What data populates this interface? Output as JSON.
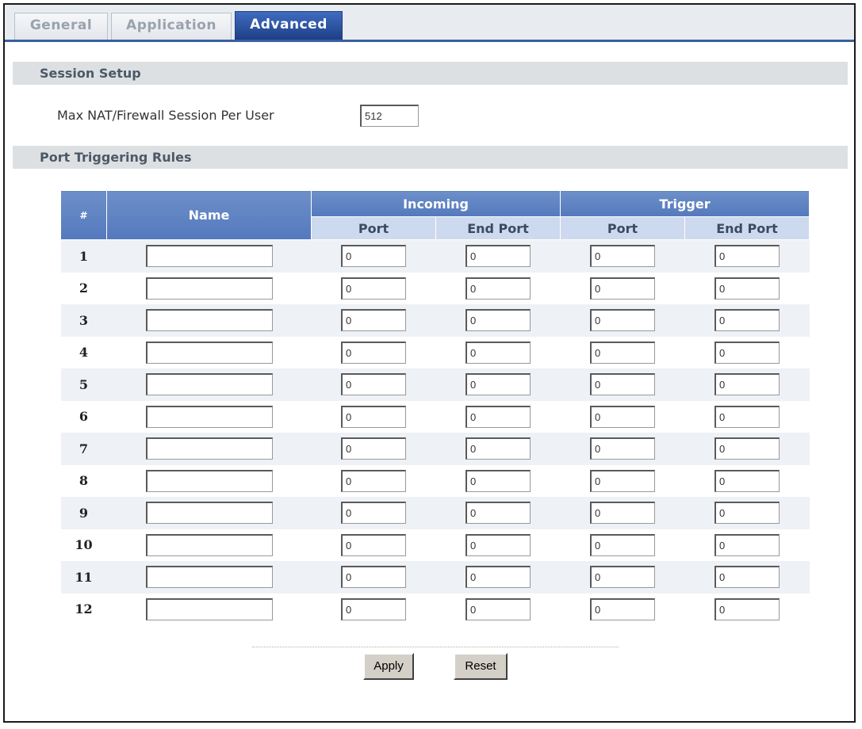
{
  "tabs": [
    {
      "label": "General",
      "active": false
    },
    {
      "label": "Application",
      "active": false
    },
    {
      "label": "Advanced",
      "active": true
    }
  ],
  "session_setup": {
    "title": "Session Setup",
    "max_session_label": "Max NAT/Firewall Session Per User",
    "max_session_value": "512"
  },
  "port_triggering": {
    "title": "Port Triggering Rules",
    "headers": {
      "index": "#",
      "name": "Name",
      "incoming": "Incoming",
      "trigger": "Trigger",
      "port": "Port",
      "end_port": "End Port"
    },
    "rows": [
      {
        "num": "1",
        "name": "",
        "in_port": "0",
        "in_end": "0",
        "tr_port": "0",
        "tr_end": "0"
      },
      {
        "num": "2",
        "name": "",
        "in_port": "0",
        "in_end": "0",
        "tr_port": "0",
        "tr_end": "0"
      },
      {
        "num": "3",
        "name": "",
        "in_port": "0",
        "in_end": "0",
        "tr_port": "0",
        "tr_end": "0"
      },
      {
        "num": "4",
        "name": "",
        "in_port": "0",
        "in_end": "0",
        "tr_port": "0",
        "tr_end": "0"
      },
      {
        "num": "5",
        "name": "",
        "in_port": "0",
        "in_end": "0",
        "tr_port": "0",
        "tr_end": "0"
      },
      {
        "num": "6",
        "name": "",
        "in_port": "0",
        "in_end": "0",
        "tr_port": "0",
        "tr_end": "0"
      },
      {
        "num": "7",
        "name": "",
        "in_port": "0",
        "in_end": "0",
        "tr_port": "0",
        "tr_end": "0"
      },
      {
        "num": "8",
        "name": "",
        "in_port": "0",
        "in_end": "0",
        "tr_port": "0",
        "tr_end": "0"
      },
      {
        "num": "9",
        "name": "",
        "in_port": "0",
        "in_end": "0",
        "tr_port": "0",
        "tr_end": "0"
      },
      {
        "num": "10",
        "name": "",
        "in_port": "0",
        "in_end": "0",
        "tr_port": "0",
        "tr_end": "0"
      },
      {
        "num": "11",
        "name": "",
        "in_port": "0",
        "in_end": "0",
        "tr_port": "0",
        "tr_end": "0"
      },
      {
        "num": "12",
        "name": "",
        "in_port": "0",
        "in_end": "0",
        "tr_port": "0",
        "tr_end": "0"
      }
    ]
  },
  "buttons": {
    "apply": "Apply",
    "reset": "Reset"
  }
}
